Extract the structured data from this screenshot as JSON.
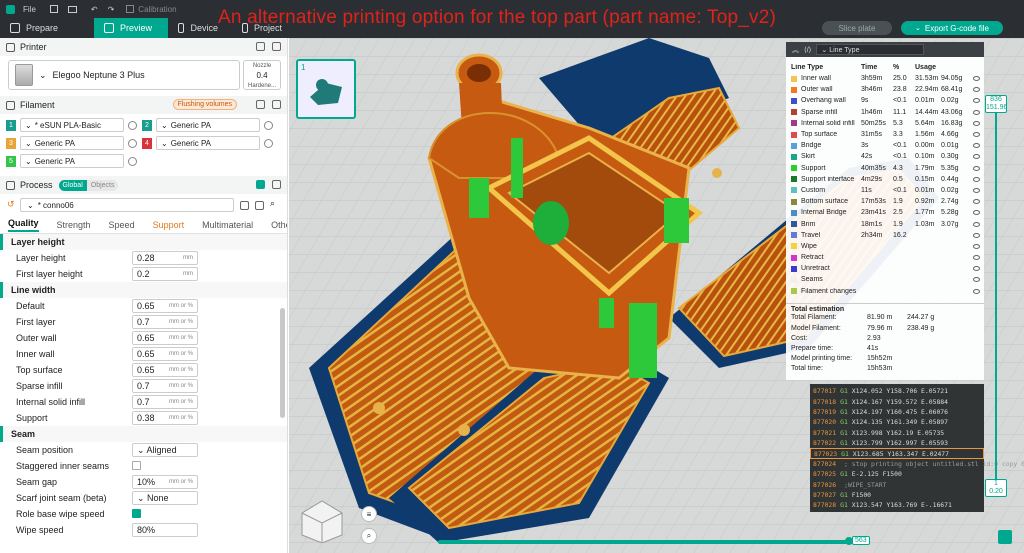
{
  "title_bar": {
    "file_label": "File",
    "calibration_label": "Calibration"
  },
  "tabs": [
    {
      "label": "Prepare"
    },
    {
      "label": "Preview"
    },
    {
      "label": "Device"
    },
    {
      "label": "Project"
    }
  ],
  "overlay_title": "An alternative printing option for the top part (part name: Top_v2)",
  "actions": {
    "slice_plate": "Slice plate",
    "export_gcode": "Export G-code file"
  },
  "printer": {
    "header": "Printer",
    "name": "Elegoo Neptune 3 Plus",
    "nozzle_label": "Nozzle",
    "nozzle_value": "0.4",
    "nozzle_type": "Hardene..."
  },
  "filament": {
    "header": "Filament",
    "flushing_label": "Flushing volumes",
    "items": [
      {
        "num": "1",
        "color": "#1a9d8f",
        "name": "* eSUN PLA-Basic"
      },
      {
        "num": "2",
        "color": "#1a9d8f",
        "name": "Generic PA"
      },
      {
        "num": "3",
        "color": "#e6a63a",
        "name": "Generic PA"
      },
      {
        "num": "4",
        "color": "#d8343a",
        "name": "Generic PA"
      },
      {
        "num": "5",
        "color": "#35c44a",
        "name": "Generic PA"
      }
    ]
  },
  "process": {
    "header": "Process",
    "toggle_global": "Global",
    "toggle_objects": "Objects",
    "preset": "* conno06",
    "tabs": [
      "Quality",
      "Strength",
      "Speed",
      "Support",
      "Multimaterial",
      "Others"
    ]
  },
  "quality": {
    "layer_height": {
      "title": "Layer height",
      "rows": [
        {
          "label": "Layer height",
          "value": "0.28",
          "unit": "mm"
        },
        {
          "label": "First layer height",
          "value": "0.2",
          "unit": "mm"
        }
      ]
    },
    "line_width": {
      "title": "Line width",
      "rows": [
        {
          "label": "Default",
          "value": "0.65",
          "unit": "mm or %"
        },
        {
          "label": "First layer",
          "value": "0.7",
          "unit": "mm or %"
        },
        {
          "label": "Outer wall",
          "value": "0.65",
          "unit": "mm or %"
        },
        {
          "label": "Inner wall",
          "value": "0.65",
          "unit": "mm or %"
        },
        {
          "label": "Top surface",
          "value": "0.65",
          "unit": "mm or %"
        },
        {
          "label": "Sparse infill",
          "value": "0.7",
          "unit": "mm or %"
        },
        {
          "label": "Internal solid infill",
          "value": "0.7",
          "unit": "mm or %"
        },
        {
          "label": "Support",
          "value": "0.38",
          "unit": "mm or %"
        }
      ]
    },
    "seam": {
      "title": "Seam",
      "seam_position_label": "Seam position",
      "seam_position_value": "Aligned",
      "staggered_label": "Staggered inner seams",
      "seam_gap_label": "Seam gap",
      "seam_gap_value": "10%",
      "seam_gap_unit": "mm or %",
      "scarf_label": "Scarf joint seam (beta)",
      "scarf_value": "None",
      "role_wipe_label": "Role base wipe speed",
      "wipe_speed_label": "Wipe speed",
      "wipe_speed_value": "80%"
    }
  },
  "plate": {
    "number": "1"
  },
  "legend": {
    "type_selector": "Line Type",
    "headers": [
      "Line Type",
      "Time",
      "%",
      "Usage"
    ],
    "rows": [
      {
        "name": "Inner wall",
        "color": "#f2c64b",
        "time": "3h59m",
        "pct": "25.0",
        "len": "31.53m",
        "wt": "94.05g"
      },
      {
        "name": "Outer wall",
        "color": "#f07a1c",
        "time": "3h46m",
        "pct": "23.8",
        "len": "22.94m",
        "wt": "68.41g"
      },
      {
        "name": "Overhang wall",
        "color": "#3d4fc9",
        "time": "9s",
        "pct": "<0.1",
        "len": "0.01m",
        "wt": "0.02g"
      },
      {
        "name": "Sparse infill",
        "color": "#b4412b",
        "time": "1h46m",
        "pct": "11.1",
        "len": "14.44m",
        "wt": "43.06g"
      },
      {
        "name": "Internal solid infill",
        "color": "#a03a8f",
        "time": "50m25s",
        "pct": "5.3",
        "len": "5.64m",
        "wt": "16.83g"
      },
      {
        "name": "Top surface",
        "color": "#e04a4a",
        "time": "31m5s",
        "pct": "3.3",
        "len": "1.56m",
        "wt": "4.66g"
      },
      {
        "name": "Bridge",
        "color": "#5aa0d6",
        "time": "3s",
        "pct": "<0.1",
        "len": "0.00m",
        "wt": "0.01g"
      },
      {
        "name": "Skirt",
        "color": "#1aa58c",
        "time": "42s",
        "pct": "<0.1",
        "len": "0.10m",
        "wt": "0.30g"
      },
      {
        "name": "Support",
        "color": "#26d12e",
        "time": "40m35s",
        "pct": "4.3",
        "len": "1.79m",
        "wt": "5.35g"
      },
      {
        "name": "Support interface",
        "color": "#1b7a2a",
        "time": "4m29s",
        "pct": "0.5",
        "len": "0.15m",
        "wt": "0.44g"
      },
      {
        "name": "Custom",
        "color": "#5dc2ba",
        "time": "11s",
        "pct": "<0.1",
        "len": "0.01m",
        "wt": "0.02g"
      },
      {
        "name": "Bottom surface",
        "color": "#8a8a3a",
        "time": "17m53s",
        "pct": "1.9",
        "len": "0.92m",
        "wt": "2.74g"
      },
      {
        "name": "Internal Bridge",
        "color": "#4a8fbf",
        "time": "23m41s",
        "pct": "2.5",
        "len": "1.77m",
        "wt": "5.28g"
      },
      {
        "name": "Brim",
        "color": "#2a5aa0",
        "time": "18m1s",
        "pct": "1.9",
        "len": "1.03m",
        "wt": "3.07g"
      },
      {
        "name": "Travel",
        "color": "#5e7bd8",
        "time": "2h34m",
        "pct": "16.2",
        "len": "",
        "wt": ""
      },
      {
        "name": "Wipe",
        "color": "#f2d33b",
        "time": "",
        "pct": "",
        "len": "",
        "wt": ""
      },
      {
        "name": "Retract",
        "color": "#d033d0",
        "time": "",
        "pct": "",
        "len": "",
        "wt": ""
      },
      {
        "name": "Unretract",
        "color": "#3a3ad0",
        "time": "",
        "pct": "",
        "len": "",
        "wt": ""
      },
      {
        "name": "Seams",
        "color": "#f0f0f0",
        "time": "",
        "pct": "",
        "len": "",
        "wt": ""
      },
      {
        "name": "Filament changes",
        "color": "#a8c84a",
        "time": "",
        "pct": "",
        "len": "",
        "wt": ""
      }
    ],
    "total_estimation": {
      "title": "Total estimation",
      "rows": [
        {
          "k": "Total Filament:",
          "a": "81.90 m",
          "b": "244.27 g"
        },
        {
          "k": "Model Filament:",
          "a": "79.96 m",
          "b": "238.49 g"
        },
        {
          "k": "Cost:",
          "a": "2.93",
          "b": ""
        },
        {
          "k": "Prepare time:",
          "a": "41s",
          "b": ""
        },
        {
          "k": "Model printing time:",
          "a": "15h52m",
          "b": ""
        },
        {
          "k": "Total time:",
          "a": "15h53m",
          "b": ""
        }
      ]
    }
  },
  "gcode": [
    {
      "ln": "877017",
      "cmd": "G1",
      "args": "X124.052 Y158.706 E.05721",
      "current": false
    },
    {
      "ln": "877018",
      "cmd": "G1",
      "args": "X124.167 Y159.572 E.05884",
      "current": false
    },
    {
      "ln": "877019",
      "cmd": "G1",
      "args": "X124.197 Y160.475 E.06076",
      "current": false
    },
    {
      "ln": "877020",
      "cmd": "G1",
      "args": "X124.135 Y161.349 E.05897",
      "current": false
    },
    {
      "ln": "877021",
      "cmd": "G1",
      "args": "X123.998 Y162.19 E.05735",
      "current": false
    },
    {
      "ln": "877022",
      "cmd": "G1",
      "args": "X123.799 Y162.997 E.05593",
      "current": false
    },
    {
      "ln": "877023",
      "cmd": "G1",
      "args": "X123.685 Y163.347 E.02477",
      "current": true
    },
    {
      "ln": "877024",
      "cmd": "",
      "args": "; stop printing object untitled.stl id:0 copy 0",
      "current": false
    },
    {
      "ln": "877025",
      "cmd": "G1",
      "args": "E-2.125 F1500",
      "current": false
    },
    {
      "ln": "877026",
      "cmd": "",
      "args": ";WIPE_START",
      "current": false
    },
    {
      "ln": "877027",
      "cmd": "G1",
      "args": "F1500",
      "current": false
    },
    {
      "ln": "877028",
      "cmd": "G1",
      "args": "X123.547 Y163.769 E-.16671",
      "current": false
    }
  ],
  "layer_slider": {
    "top_layer": "836",
    "top_height": "151.96",
    "bottom_layer": "1",
    "bottom_height": "0.20"
  },
  "move_slider": {
    "value": "563"
  },
  "colors": {
    "accent": "#00a88f",
    "top_bar": "#2b2f33",
    "overlay_red": "#e0221b"
  }
}
